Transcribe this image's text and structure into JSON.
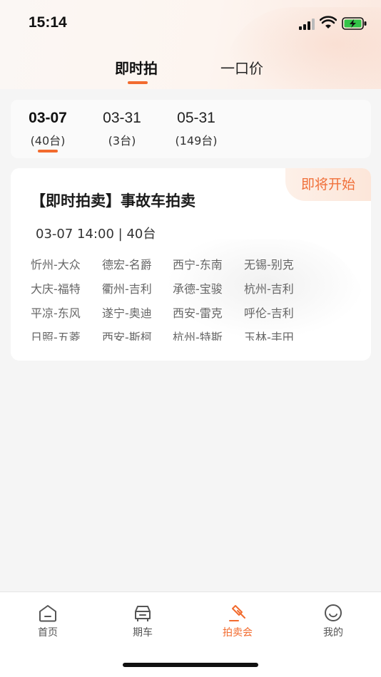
{
  "status_bar": {
    "time": "15:14"
  },
  "segment_tabs": [
    {
      "label": "即时拍",
      "active": true
    },
    {
      "label": "一口价",
      "active": false
    }
  ],
  "date_tabs": [
    {
      "date": "03-07",
      "count": "(40台)",
      "active": true
    },
    {
      "date": "03-31",
      "count": "(3台)",
      "active": false
    },
    {
      "date": "05-31",
      "count": "(149台)",
      "active": false
    }
  ],
  "auction_card": {
    "status_badge": "即将开始",
    "title": "【即时拍卖】事故车拍卖",
    "time": "03-07 14:00",
    "count": "40台",
    "brands": [
      "忻州-大众",
      "德宏-名爵",
      "西宁-东南",
      "无锡-别克",
      "大庆-福特",
      "衢州-吉利",
      "承德-宝骏",
      "杭州-吉利",
      "平凉-东风",
      "遂宁-奥迪",
      "西安-雷克",
      "呼伦-吉利",
      "日照-五菱",
      "西安-斯柯",
      "杭州-特斯",
      "玉林-丰田"
    ]
  },
  "bottom_nav": [
    {
      "label": "首页",
      "icon": "home-icon",
      "active": false
    },
    {
      "label": "期车",
      "icon": "car-icon",
      "active": false
    },
    {
      "label": "拍卖会",
      "icon": "gavel-icon",
      "active": true
    },
    {
      "label": "我的",
      "icon": "smile-icon",
      "active": false
    }
  ],
  "colors": {
    "accent": "#f26b2e",
    "badge_text": "#f0703a"
  }
}
